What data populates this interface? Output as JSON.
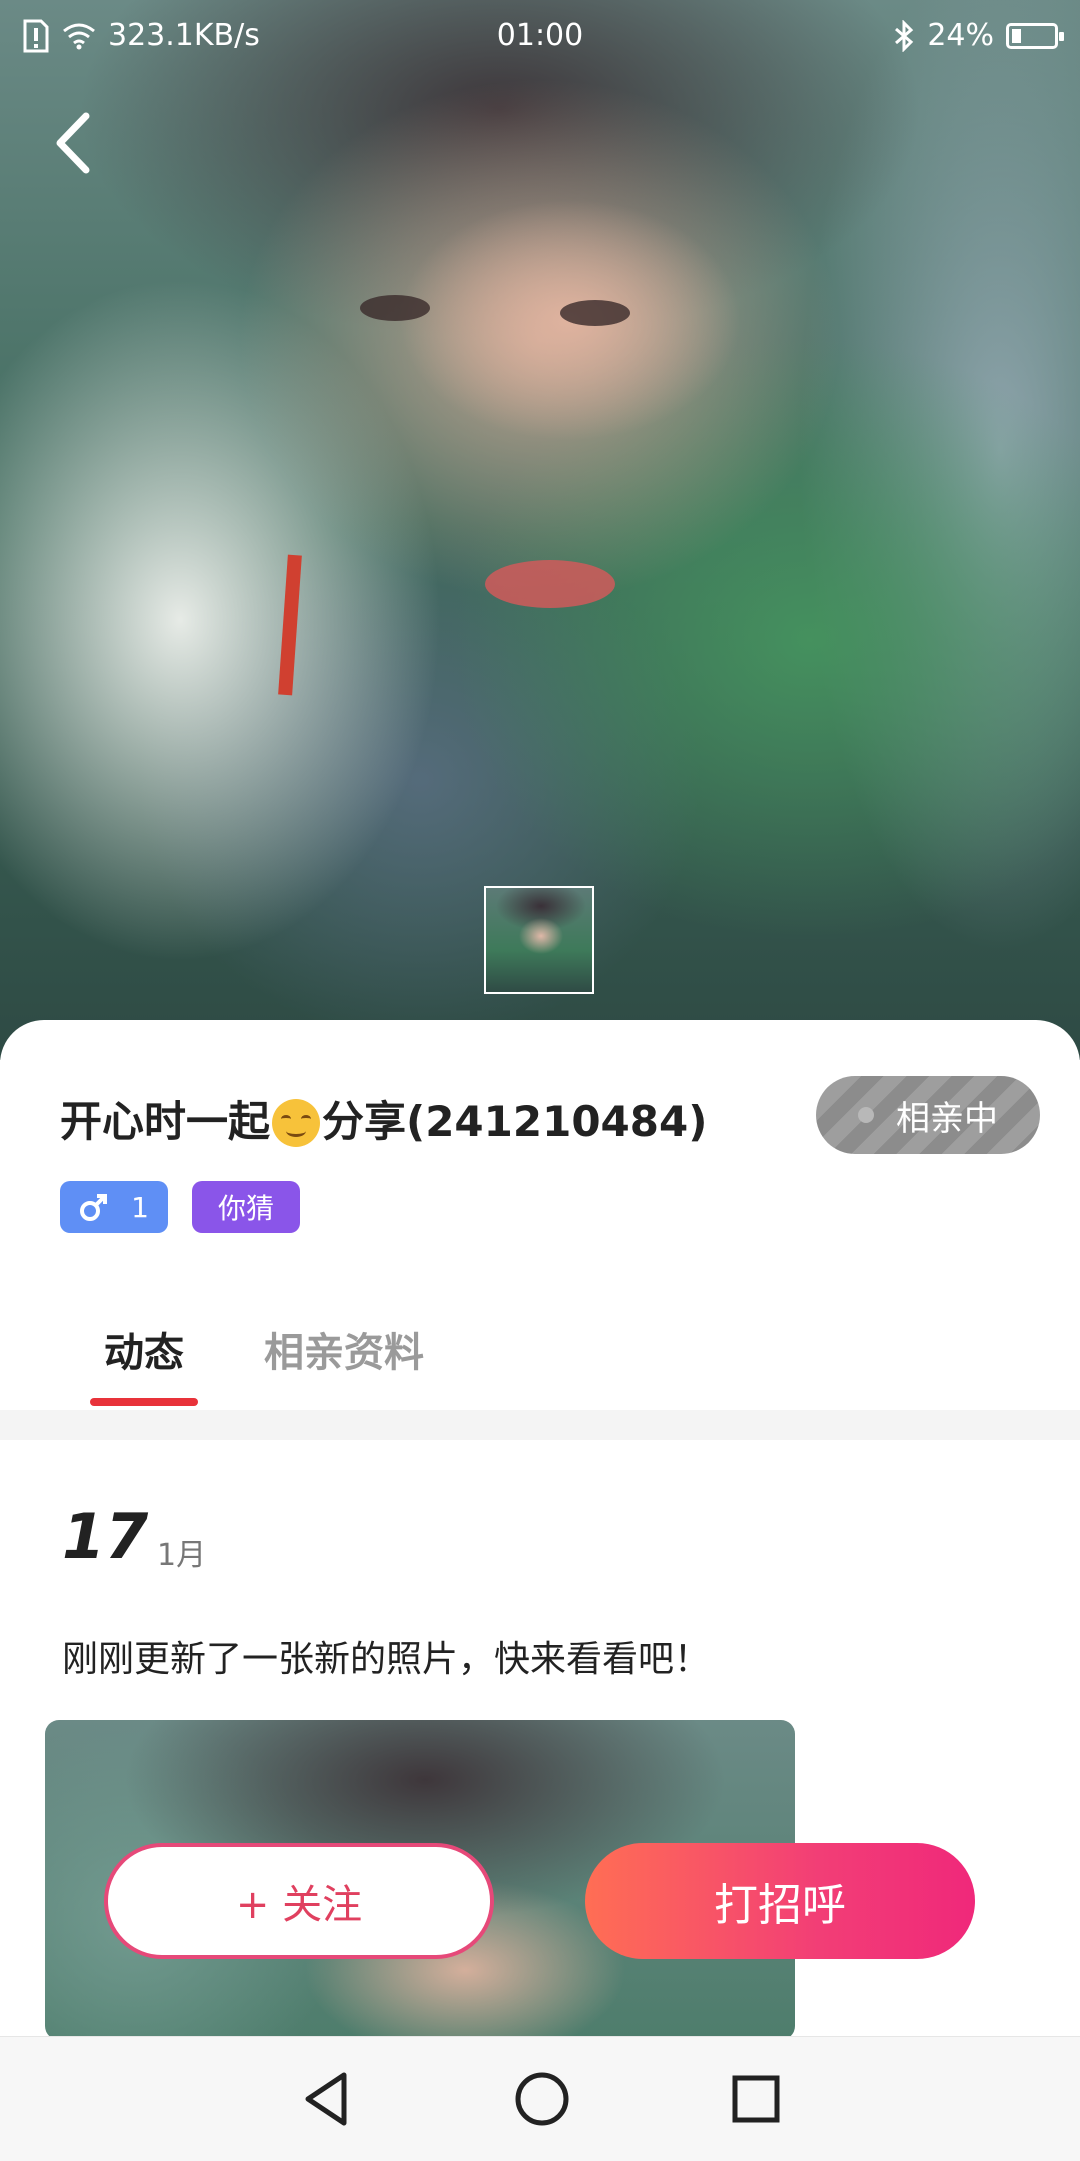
{
  "status_bar": {
    "network_speed": "323.1KB/s",
    "time": "01:00",
    "battery_percent": "24%",
    "battery_level": 0.24
  },
  "profile": {
    "name_part1": "开心时一起",
    "name_part2": "分享(241210484)",
    "status_label": "相亲中",
    "gender_age": "1",
    "guess_tag": "你猜"
  },
  "tabs": [
    {
      "label": "动态",
      "active": true
    },
    {
      "label": "相亲资料",
      "active": false
    }
  ],
  "post": {
    "day": "17",
    "month": "1月",
    "text": "刚刚更新了一张新的照片，快来看看吧！"
  },
  "actions": {
    "follow_label": "+ 关注",
    "greet_label": "打招呼"
  },
  "colors": {
    "accent": "#e8323a",
    "follow_border": "#e64979",
    "greet_gradient_start": "#ff6e54",
    "greet_gradient_end": "#f0287a",
    "gender_tag": "#5f8ff5",
    "guess_tag": "#8a55e9"
  }
}
